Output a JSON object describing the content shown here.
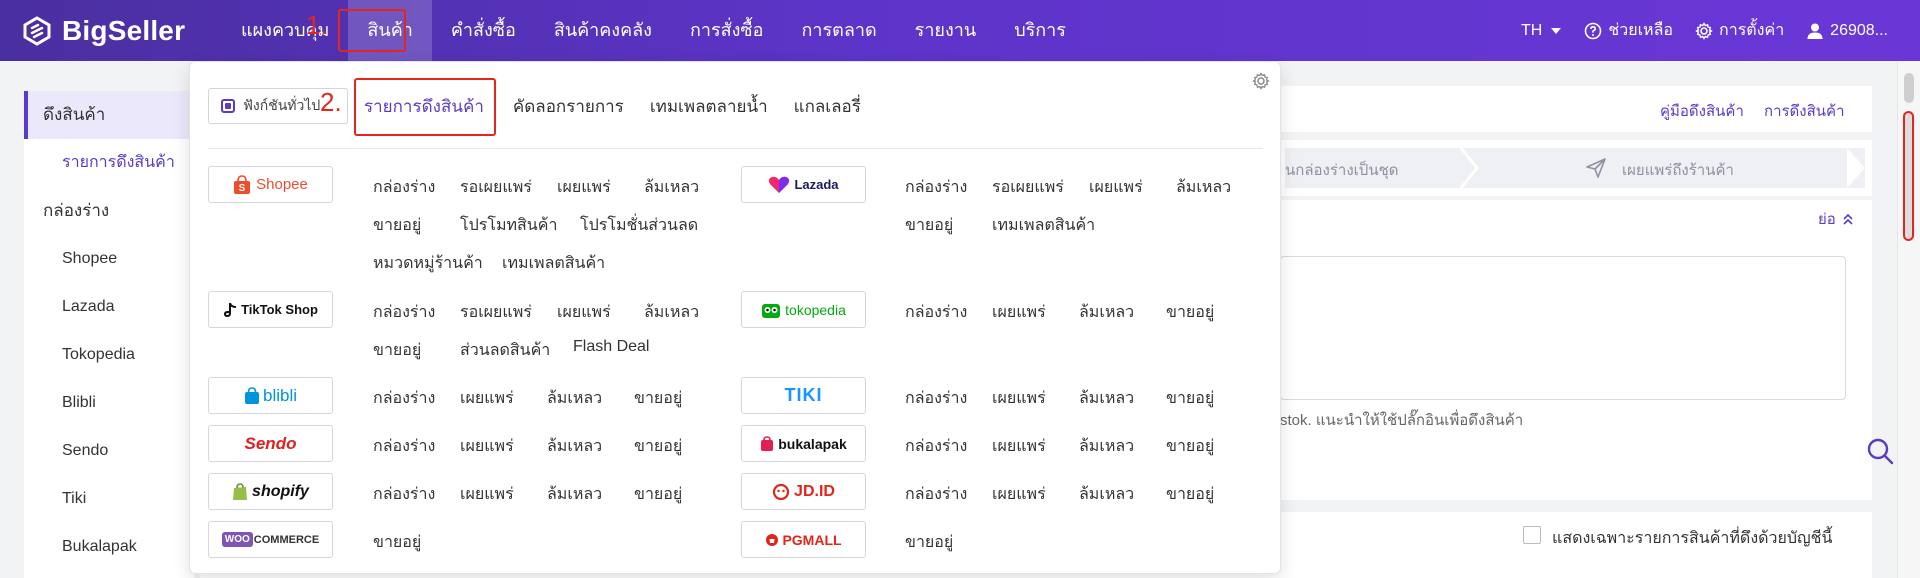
{
  "app": {
    "logo_text": "BigSeller",
    "brand_color": "#5b3bc6",
    "annotation_color": "#e3261d"
  },
  "nav": {
    "items": [
      {
        "label": "แผงควบคุม"
      },
      {
        "label": "สินค้า",
        "active": true
      },
      {
        "label": "คำสั่งซื้อ"
      },
      {
        "label": "สินค้าคงคลัง"
      },
      {
        "label": "การสั่งซื้อ"
      },
      {
        "label": "การตลาด"
      },
      {
        "label": "รายงาน"
      },
      {
        "label": "บริการ"
      }
    ],
    "language": "TH",
    "help": "ช่วยเหลือ",
    "settings": "การตั้งค่า",
    "user": "26908..."
  },
  "annotations": {
    "one": "1.",
    "two": "2."
  },
  "sidebar": {
    "section1": "ดึงสินค้า",
    "section1_sub": "รายการดึงสินค้า",
    "section2": "กล่องร่าง",
    "items": [
      "Shopee",
      "Lazada",
      "Tokopedia",
      "Blibli",
      "Sendo",
      "Tiki",
      "Bukalapak"
    ]
  },
  "background": {
    "link_guide": "คู่มือดึงสินค้า",
    "link_pull": "การดึงสินค้า",
    "step_partial": "นกล่องร่างเป็นชุด",
    "step_publish": "เผยแพร่ถึงร้านค้า",
    "collapse": "ย่อ",
    "hint": "stok. แนะนำให้ใช้ปลั๊กอินเพื่อดึงสินค้า",
    "checkbox_label": "แสดงเฉพาะรายการสินค้าที่ดึงด้วยบัญชีนี้"
  },
  "dropdown": {
    "plugin_button": "ฟังก์ชันทั่วไป",
    "tabs": [
      "รายการดึงสินค้า",
      "คัดลอกรายการ",
      "เทมเพลตลายน้ำ",
      "แกลเลอรี่"
    ],
    "platforms": {
      "shopee": {
        "name": "Shopee",
        "links": [
          "กล่องร่าง",
          "รอเผยแพร่",
          "เผยแพร่",
          "ล้มเหลว",
          "ขายอยู่",
          "โปรโมทสินค้า",
          "โปรโมชั่นส่วนลด",
          "หมวดหมู่ร้านค้า",
          "เทมเพลตสินค้า"
        ]
      },
      "lazada": {
        "name": "Lazada",
        "links": [
          "กล่องร่าง",
          "รอเผยแพร่",
          "เผยแพร่",
          "ล้มเหลว",
          "ขายอยู่",
          "เทมเพลตสินค้า"
        ]
      },
      "tiktok": {
        "name": "TikTok Shop",
        "links": [
          "กล่องร่าง",
          "รอเผยแพร่",
          "เผยแพร่",
          "ล้มเหลว",
          "ขายอยู่",
          "ส่วนลดสินค้า",
          "Flash Deal"
        ]
      },
      "tokopedia": {
        "name": "tokopedia",
        "links": [
          "กล่องร่าง",
          "เผยแพร่",
          "ล้มเหลว",
          "ขายอยู่"
        ]
      },
      "blibli": {
        "name": "blibli",
        "links": [
          "กล่องร่าง",
          "เผยแพร่",
          "ล้มเหลว",
          "ขายอยู่"
        ]
      },
      "tiki": {
        "name": "TIKI",
        "links": [
          "กล่องร่าง",
          "เผยแพร่",
          "ล้มเหลว",
          "ขายอยู่"
        ]
      },
      "sendo": {
        "name": "Sendo",
        "links": [
          "กล่องร่าง",
          "เผยแพร่",
          "ล้มเหลว",
          "ขายอยู่"
        ]
      },
      "bukalapak": {
        "name": "bukalapak",
        "links": [
          "กล่องร่าง",
          "เผยแพร่",
          "ล้มเหลว",
          "ขายอยู่"
        ]
      },
      "shopify": {
        "name": "shopify",
        "links": [
          "กล่องร่าง",
          "เผยแพร่",
          "ล้มเหลว",
          "ขายอยู่"
        ]
      },
      "jdid": {
        "name": "JD.ID",
        "links": [
          "กล่องร่าง",
          "เผยแพร่",
          "ล้มเหลว",
          "ขายอยู่"
        ]
      },
      "woocommerce": {
        "name": "COMMERCE",
        "links": [
          "ขายอยู่"
        ]
      },
      "pgmall": {
        "name": "PGMALL",
        "links": [
          "ขายอยู่"
        ]
      }
    }
  }
}
